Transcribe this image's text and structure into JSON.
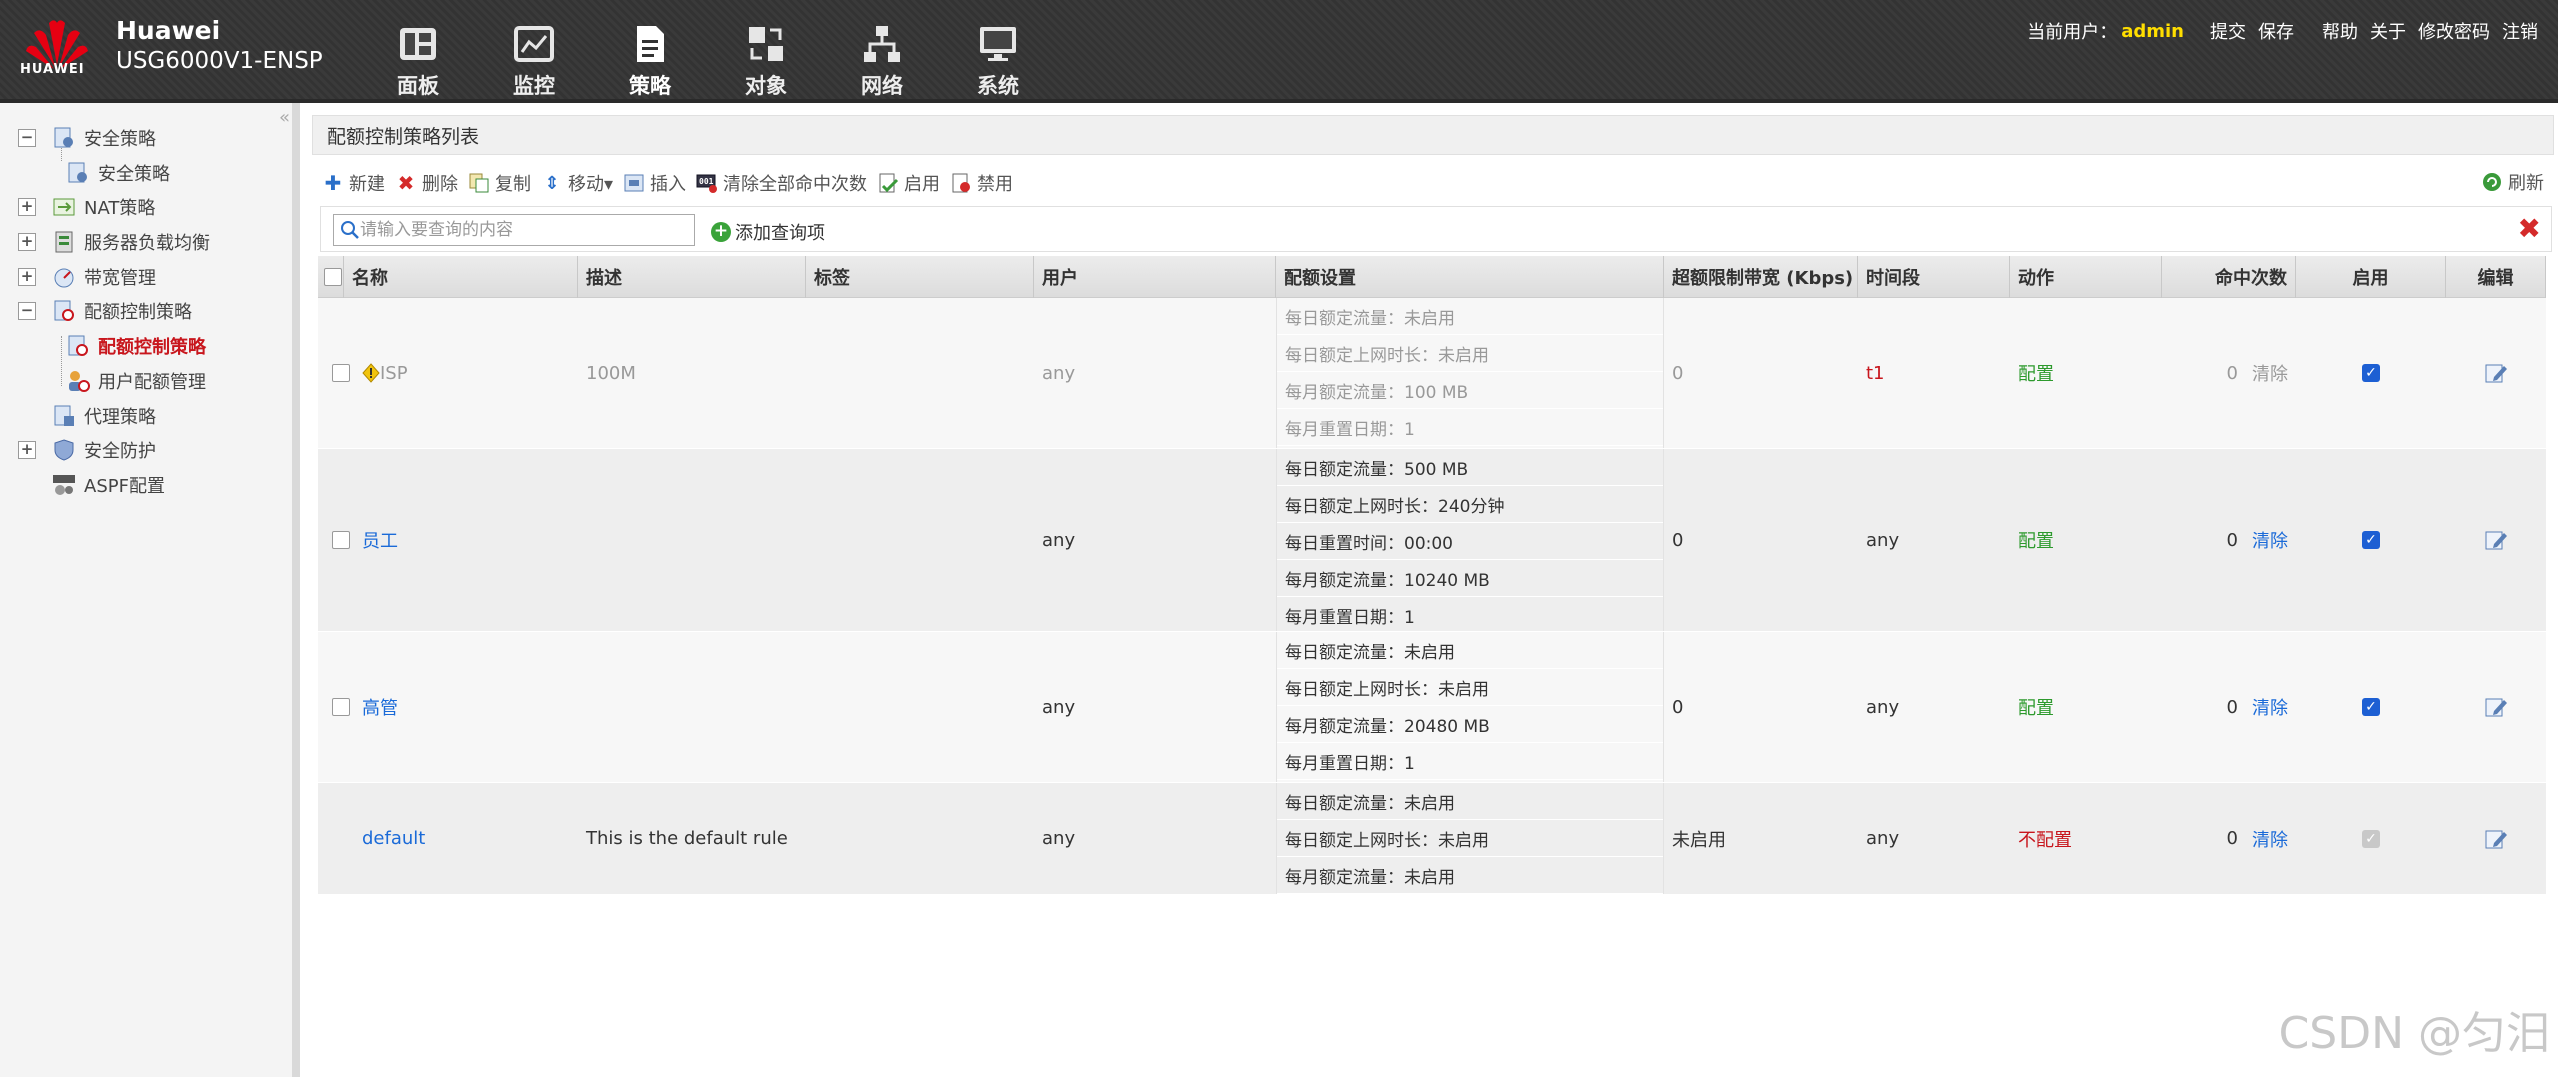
{
  "header": {
    "brand": "HUAWEI",
    "vendor": "Huawei",
    "model": "USG6000V1-ENSP",
    "nav": [
      {
        "label": "面板",
        "icon": "dashboard-icon"
      },
      {
        "label": "监控",
        "icon": "monitor-icon"
      },
      {
        "label": "策略",
        "icon": "policy-icon",
        "active": true
      },
      {
        "label": "对象",
        "icon": "object-icon"
      },
      {
        "label": "网络",
        "icon": "network-icon"
      },
      {
        "label": "系统",
        "icon": "system-icon"
      }
    ],
    "user_label": "当前用户：",
    "user_name": "admin",
    "links": [
      "提交",
      "保存",
      "帮助",
      "关于",
      "修改密码",
      "注销"
    ]
  },
  "sidebar": {
    "collapse": "«",
    "items": [
      {
        "label": "安全策略",
        "toggle": "−"
      },
      {
        "label": "安全策略"
      },
      {
        "label": "NAT策略",
        "toggle": "+"
      },
      {
        "label": "服务器负载均衡",
        "toggle": "+"
      },
      {
        "label": "带宽管理",
        "toggle": "+"
      },
      {
        "label": "配额控制策略",
        "toggle": "−"
      },
      {
        "label": "配额控制策略",
        "selected": true
      },
      {
        "label": "用户配额管理"
      },
      {
        "label": "代理策略"
      },
      {
        "label": "安全防护",
        "toggle": "+"
      },
      {
        "label": "ASPF配置"
      }
    ]
  },
  "panel": {
    "title": "配额控制策略列表",
    "toolbar": [
      "新建",
      "删除",
      "复制",
      "移动▾",
      "插入",
      "清除全部命中次数",
      "启用",
      "禁用"
    ],
    "refresh": "刷新",
    "search_placeholder": "请输入要查询的内容",
    "add_query": "添加查询项",
    "close": "✖"
  },
  "table": {
    "columns": [
      "名称",
      "描述",
      "标签",
      "用户",
      "配额设置",
      "超额限制带宽 (Kbps)",
      "时间段",
      "动作",
      "命中次数",
      "启用",
      "编辑"
    ],
    "rows": [
      {
        "name": "ISP",
        "description": "100M",
        "tag": "",
        "user": "any",
        "quota": [
          "每日额定流量：未启用",
          "每日额定上网时长：未启用",
          "每月额定流量：100 MB",
          "每月重置日期：1"
        ],
        "bandwidth": "0",
        "time": "t1",
        "action": "配置",
        "hits": "0",
        "clear": "清除",
        "enabled": true
      },
      {
        "name": "员工",
        "description": "",
        "tag": "",
        "user": "any",
        "quota": [
          "每日额定流量：500 MB",
          "每日额定上网时长：240分钟",
          "每日重置时间：00:00",
          "每月额定流量：10240 MB",
          "每月重置日期：1"
        ],
        "bandwidth": "0",
        "time": "any",
        "action": "配置",
        "hits": "0",
        "clear": "清除",
        "enabled": true
      },
      {
        "name": "高管",
        "description": "",
        "tag": "",
        "user": "any",
        "quota": [
          "每日额定流量：未启用",
          "每日额定上网时长：未启用",
          "每月额定流量：20480 MB",
          "每月重置日期：1"
        ],
        "bandwidth": "0",
        "time": "any",
        "action": "配置",
        "hits": "0",
        "clear": "清除",
        "enabled": true
      },
      {
        "name": "default",
        "description": "This is the default rule",
        "tag": "",
        "user": "any",
        "quota": [
          "每日额定流量：未启用",
          "每日额定上网时长：未启用",
          "每月额定流量：未启用"
        ],
        "bandwidth": "未启用",
        "time": "any",
        "action": "不配置",
        "hits": "0",
        "clear": "清除",
        "enabled": true
      }
    ]
  },
  "watermark": "CSDN @匀汨",
  "colors": {
    "accent_red": "#c8161d",
    "link_blue": "#1a6ad8",
    "ok_green": "#2d9a2d",
    "user_yellow": "#ffde00"
  }
}
